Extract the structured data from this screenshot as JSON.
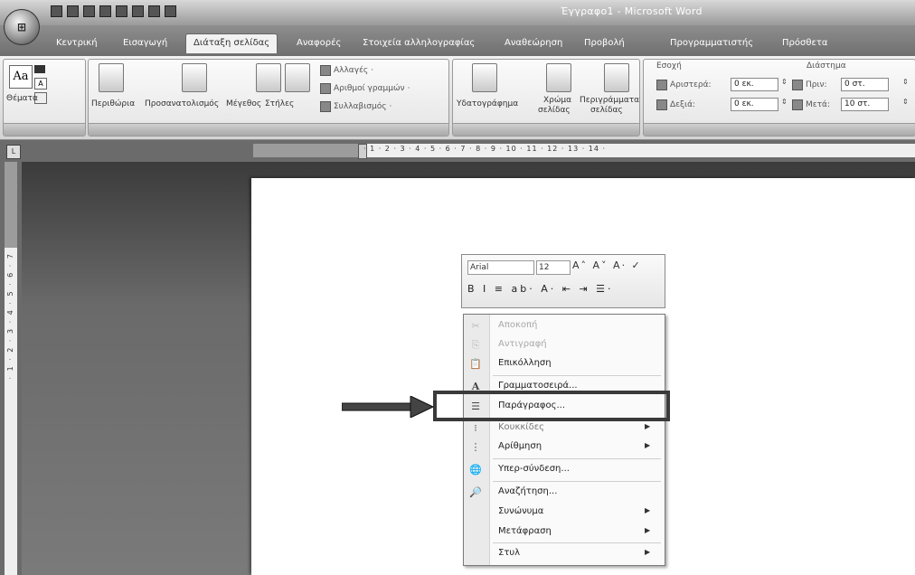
{
  "window": {
    "title": "Έγγραφο1 - Microsoft Word"
  },
  "tabs": [
    {
      "label": "Κεντρική"
    },
    {
      "label": "Εισαγωγή"
    },
    {
      "label": "Διάταξη σελίδας"
    },
    {
      "label": "Αναφορές"
    },
    {
      "label": "Στοιχεία αλληλογραφίας"
    },
    {
      "label": "Αναθεώρηση"
    },
    {
      "label": "Προβολή"
    },
    {
      "label": "Προγραμματιστής"
    },
    {
      "label": "Πρόσθετα"
    }
  ],
  "ribbon": {
    "themes": {
      "button": "Θέματα"
    },
    "page_setup": {
      "margins": "Περιθώρια",
      "orientation": "Προσανατολισμός",
      "size": "Μέγεθος",
      "columns": "Στήλες",
      "breaks": "Αλλαγές",
      "line_numbers": "Αριθμοί γραμμών",
      "hyphenation": "Συλλαβισμός"
    },
    "page_background": {
      "watermark": "Υδατογράφημα",
      "page_color_line1": "Χρώμα",
      "page_color_line2": "σελίδας",
      "page_borders_line1": "Περιγράμματα",
      "page_borders_line2": "σελίδας"
    },
    "paragraph": {
      "indent_header": "Εσοχή",
      "left_label": "Αριστερά:",
      "left_value": "0 εκ.",
      "right_label": "Δεξιά:",
      "right_value": "0 εκ.",
      "spacing_header": "Διάστημα",
      "before_label": "Πριν:",
      "before_value": "0 στ.",
      "after_label": "Μετά:",
      "after_value": "10 στ."
    }
  },
  "ruler": {
    "numbers": "· 1 · 2 · 3 · 4 · 5 · 6 · 7 · 8 · 9 · 10 · 11 · 12 · 13 · 14 ·"
  },
  "vruler": {
    "numbers": "· 1 · 2 · 3 · 4 · 5 · 6 · 7"
  },
  "minibar": {
    "font": "Arial",
    "size": "12",
    "row1_tools": "A˄ A˅ A· ✓",
    "row2_tools": "B I ≡ ab· A· ⇤ ⇥ ☰·"
  },
  "context_menu": {
    "items": [
      {
        "label": "Αποκοπή",
        "icon": "scissors-icon",
        "enabled": false
      },
      {
        "label": "Αντιγραφή",
        "icon": "copy-icon",
        "enabled": false
      },
      {
        "label": "Επικόλληση",
        "icon": "paste-icon",
        "enabled": true
      },
      {
        "label": "Γραμματοσειρά...",
        "icon": "font-icon",
        "enabled": true
      },
      {
        "label": "Παράγραφος...",
        "icon": "paragraph-icon",
        "enabled": true
      },
      {
        "label": "Κουκκίδες",
        "icon": "bullets-icon",
        "enabled": true
      },
      {
        "label": "Αρίθμηση",
        "icon": "numbering-icon",
        "enabled": true
      },
      {
        "label": "Υπερ-σύνδεση...",
        "icon": "hyperlink-icon",
        "enabled": true
      },
      {
        "label": "Αναζήτηση...",
        "icon": "research-icon",
        "enabled": true
      },
      {
        "label": "Συνώνυμα",
        "icon": "",
        "enabled": true
      },
      {
        "label": "Μετάφραση",
        "icon": "",
        "enabled": true
      },
      {
        "label": "Στυλ",
        "icon": "",
        "enabled": true
      }
    ]
  },
  "annotation": {
    "highlighted_item": "Παράγραφος..."
  }
}
